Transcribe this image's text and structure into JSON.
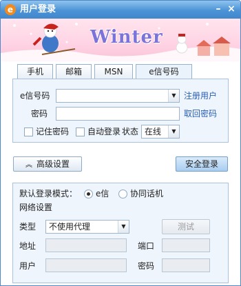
{
  "window": {
    "title": "用户登录",
    "minimize": "–",
    "close": "×"
  },
  "banner": {
    "text": "Winter"
  },
  "tabs": [
    {
      "label": "手机"
    },
    {
      "label": "邮箱"
    },
    {
      "label": "MSN"
    },
    {
      "label": "e信号码",
      "active": true
    }
  ],
  "login": {
    "account_label": "e信号码",
    "account_value": "",
    "password_label": "密码",
    "password_value": "",
    "register_link": "注册用户",
    "recover_link": "取回密码",
    "remember_label": "记住密码",
    "autologin_label": "自动登录",
    "status_label": "状态",
    "status_value": "在线"
  },
  "actions": {
    "advanced_label": "高级设置",
    "secure_login_label": "安全登录"
  },
  "advanced": {
    "mode_label": "默认登录模式：",
    "mode_options": [
      {
        "label": "e信",
        "selected": true
      },
      {
        "label": "协同话机",
        "selected": false
      }
    ],
    "network_label": "网络设置",
    "type_label": "类型",
    "type_value": "不使用代理",
    "test_label": "测试",
    "address_label": "地址",
    "port_label": "端口",
    "user_label": "用户",
    "password_label": "密码"
  },
  "colors": {
    "title_bar": "#4c93d6",
    "link": "#2a5fb2",
    "panel_bg": "#eef5fc"
  }
}
